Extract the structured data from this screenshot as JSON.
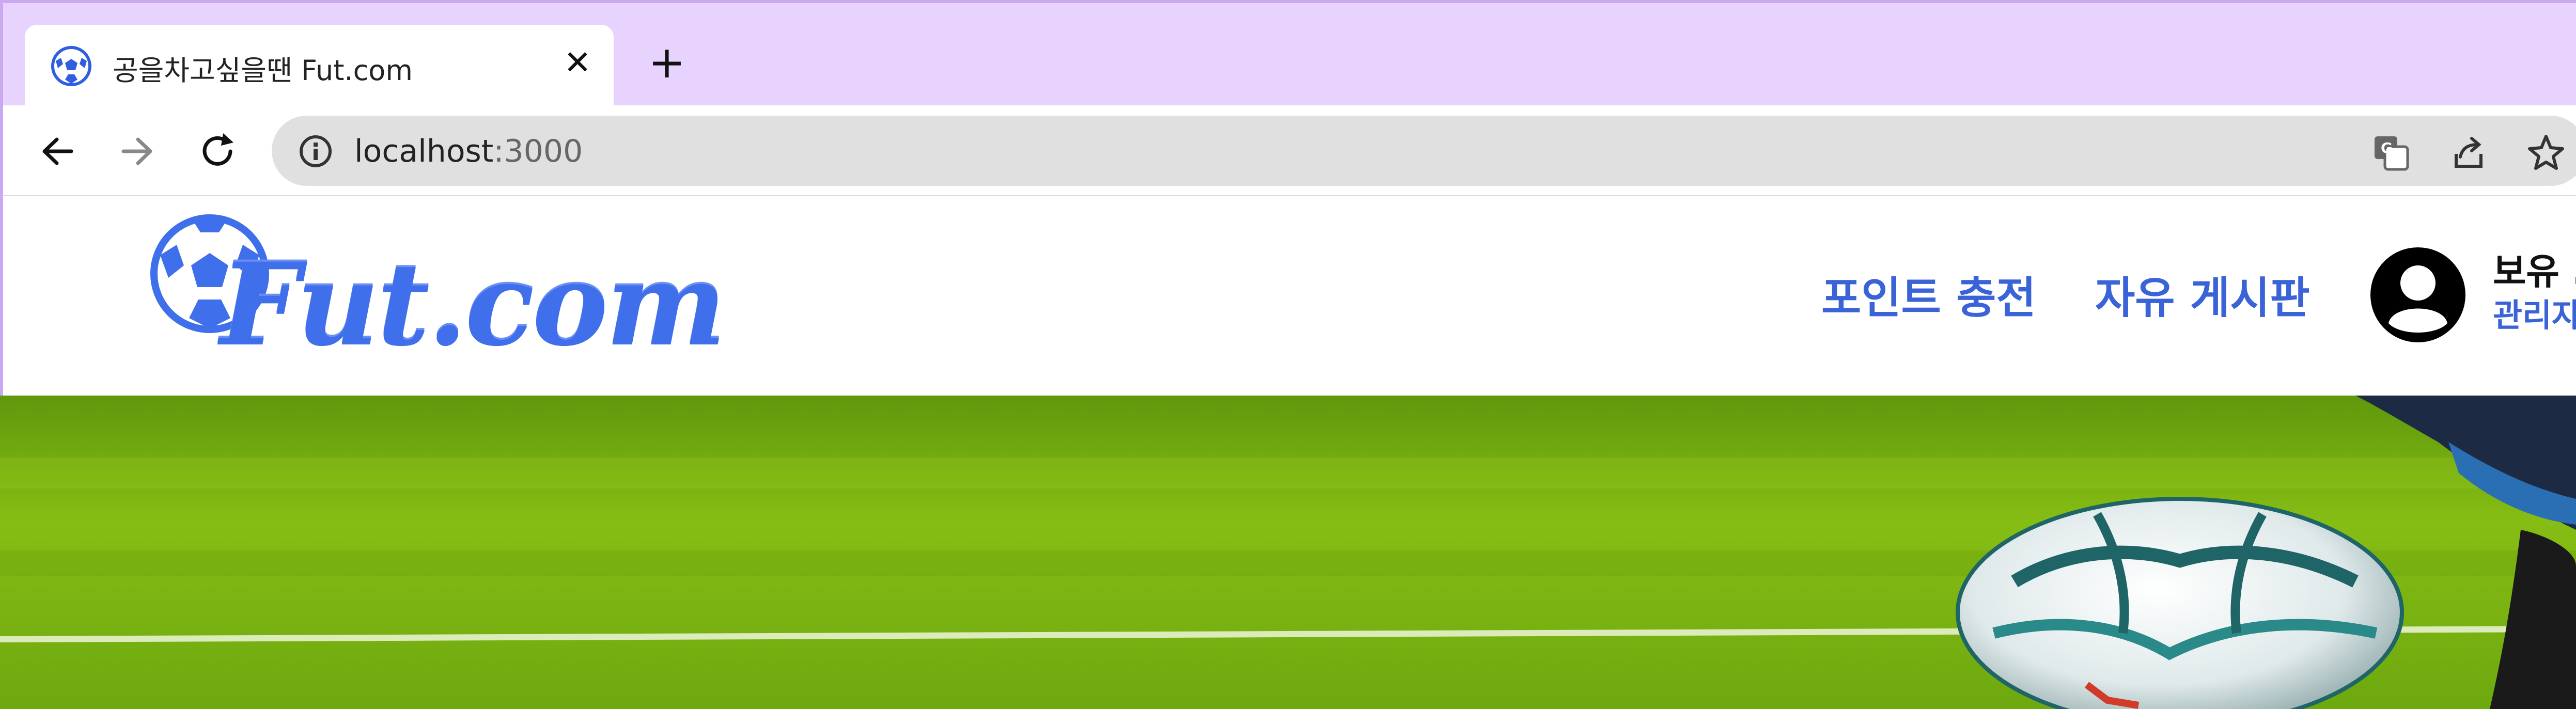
{
  "browser": {
    "tab_title": "공을차고싶을땐 Fut.com",
    "close_glyph": "✕",
    "new_tab_glyph": "+",
    "url_host": "localhost",
    "url_port": ":3000"
  },
  "site": {
    "logo_text": "Fut.com",
    "nav": [
      "포인트 충전",
      "자유 게시판"
    ],
    "user": {
      "points_label": "보유 .",
      "role_label": "관리자"
    }
  },
  "colors": {
    "tabstrip": "#e8d3ff",
    "brand_blue": "#3a63d8",
    "logo_blue": "#3f6fea",
    "grass": "#7fb812"
  },
  "icons": [
    "soccer-ball-icon",
    "close-icon",
    "plus-icon",
    "back-arrow-icon",
    "forward-arrow-icon",
    "reload-icon",
    "info-icon",
    "translate-icon",
    "share-icon",
    "star-icon",
    "user-avatar-icon"
  ]
}
